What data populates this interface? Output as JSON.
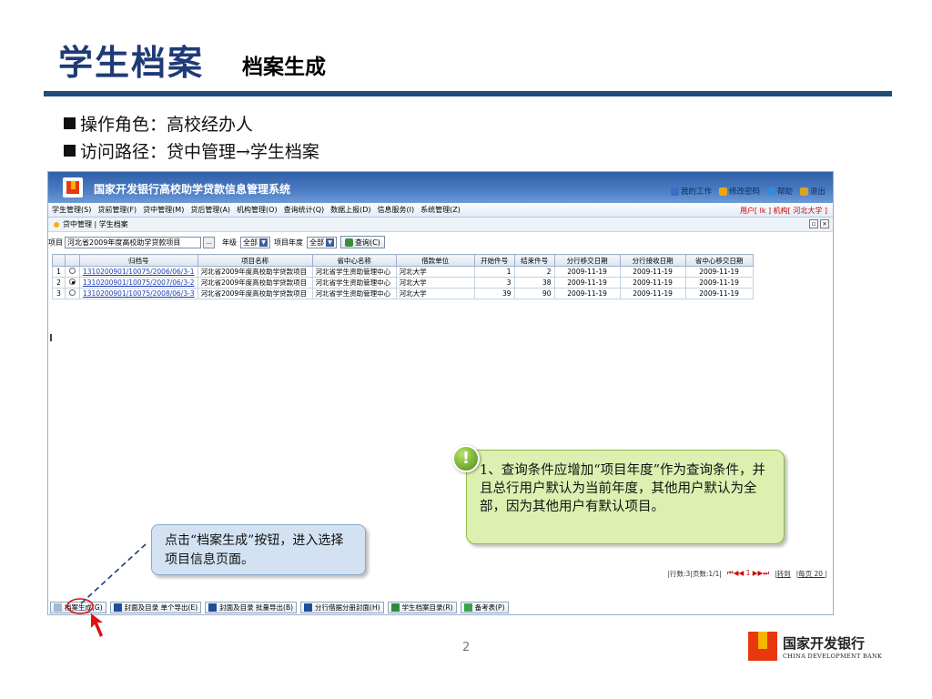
{
  "slide": {
    "title": "学生档案",
    "subtitle": "档案生成",
    "bullets": [
      "操作角色：高校经办人",
      "访问路径：贷中管理→学生档案"
    ],
    "page_number": "2"
  },
  "app": {
    "title": "国家开发银行高校助学贷款信息管理系统",
    "top_links": [
      "我的工作",
      "修改密码",
      "帮助",
      "退出"
    ],
    "user_info": "用户[ lk ]  机构[ 河北大学 ]",
    "menu": [
      "学生管理(S)",
      "贷前管理(F)",
      "贷中管理(M)",
      "贷后管理(A)",
      "机构管理(O)",
      "查询统计(Q)",
      "数据上报(D)",
      "信息服务(I)",
      "系统管理(Z)"
    ],
    "breadcrumb": "贷中管理 | 学生档案",
    "window_buttons": [
      "▫",
      "×"
    ]
  },
  "query": {
    "project_label": "项目",
    "project_value": "河北省2009年度高校助学贷款项目",
    "dots": "...",
    "grade_label": "年级",
    "grade_value": "全部",
    "year_label": "项目年度",
    "year_value": "全部",
    "query_button": "查询(C)"
  },
  "table": {
    "headers": [
      "",
      "",
      "归档号",
      "项目名称",
      "省中心名称",
      "借款单位",
      "开始件号",
      "结束件号",
      "分行移交日期",
      "分行接收日期",
      "省中心移交日期"
    ],
    "rows": [
      {
        "idx": "1",
        "checked": false,
        "archive_no": "1310200901/10075/2006/06/3-1",
        "project": "河北省2009年度高校助学贷款项目",
        "center": "河北省学生资助管理中心",
        "unit": "河北大学",
        "start": "1",
        "end": "2",
        "branch_transfer": "2009-11-19",
        "branch_receive": "2009-11-19",
        "center_transfer": "2009-11-19"
      },
      {
        "idx": "2",
        "checked": true,
        "archive_no": "1310200901/10075/2007/06/3-2",
        "project": "河北省2009年度高校助学贷款项目",
        "center": "河北省学生资助管理中心",
        "unit": "河北大学",
        "start": "3",
        "end": "38",
        "branch_transfer": "2009-11-19",
        "branch_receive": "2009-11-19",
        "center_transfer": "2009-11-19"
      },
      {
        "idx": "3",
        "checked": false,
        "archive_no": "1310200901/10075/2008/06/3-3",
        "project": "河北省2009年度高校助学贷款项目",
        "center": "河北省学生资助管理中心",
        "unit": "河北大学",
        "start": "39",
        "end": "90",
        "branch_transfer": "2009-11-19",
        "branch_receive": "2009-11-19",
        "center_transfer": "2009-11-19"
      }
    ]
  },
  "pager": {
    "info": "|行数:3|页数:1/1|",
    "nav": "⏮◀◀ 1 ▶▶⏭",
    "goto": "|转到",
    "per_page": "|每页 20 |"
  },
  "toolbar": [
    "档案生成(G)",
    "封面及目录 单个导出(E)",
    "封面及目录 批量导出(B)",
    "分行借据分册封面(H)",
    "学生档案目录(R)",
    "备考表(P)"
  ],
  "callouts": {
    "warning_mark": "!",
    "green_text": "1、查询条件应增加“项目年度”作为查询条件，并且总行用户默认为当前年度，其他用户默认为全部，因为其他用户有默认项目。",
    "blue_text": "点击“档案生成”按钮，进入选择项目信息页面。"
  },
  "brand": {
    "name_cn": "国家开发银行",
    "name_en": "CHINA DEVELOPMENT BANK"
  },
  "colors": {
    "title_blue": "#1f3b77",
    "rule": "#1f4e79",
    "header_blue": "#2f5fa6",
    "callout_green": "#ddf0b0",
    "callout_blue": "#d3e2f3",
    "annotation_red": "#e01010"
  }
}
